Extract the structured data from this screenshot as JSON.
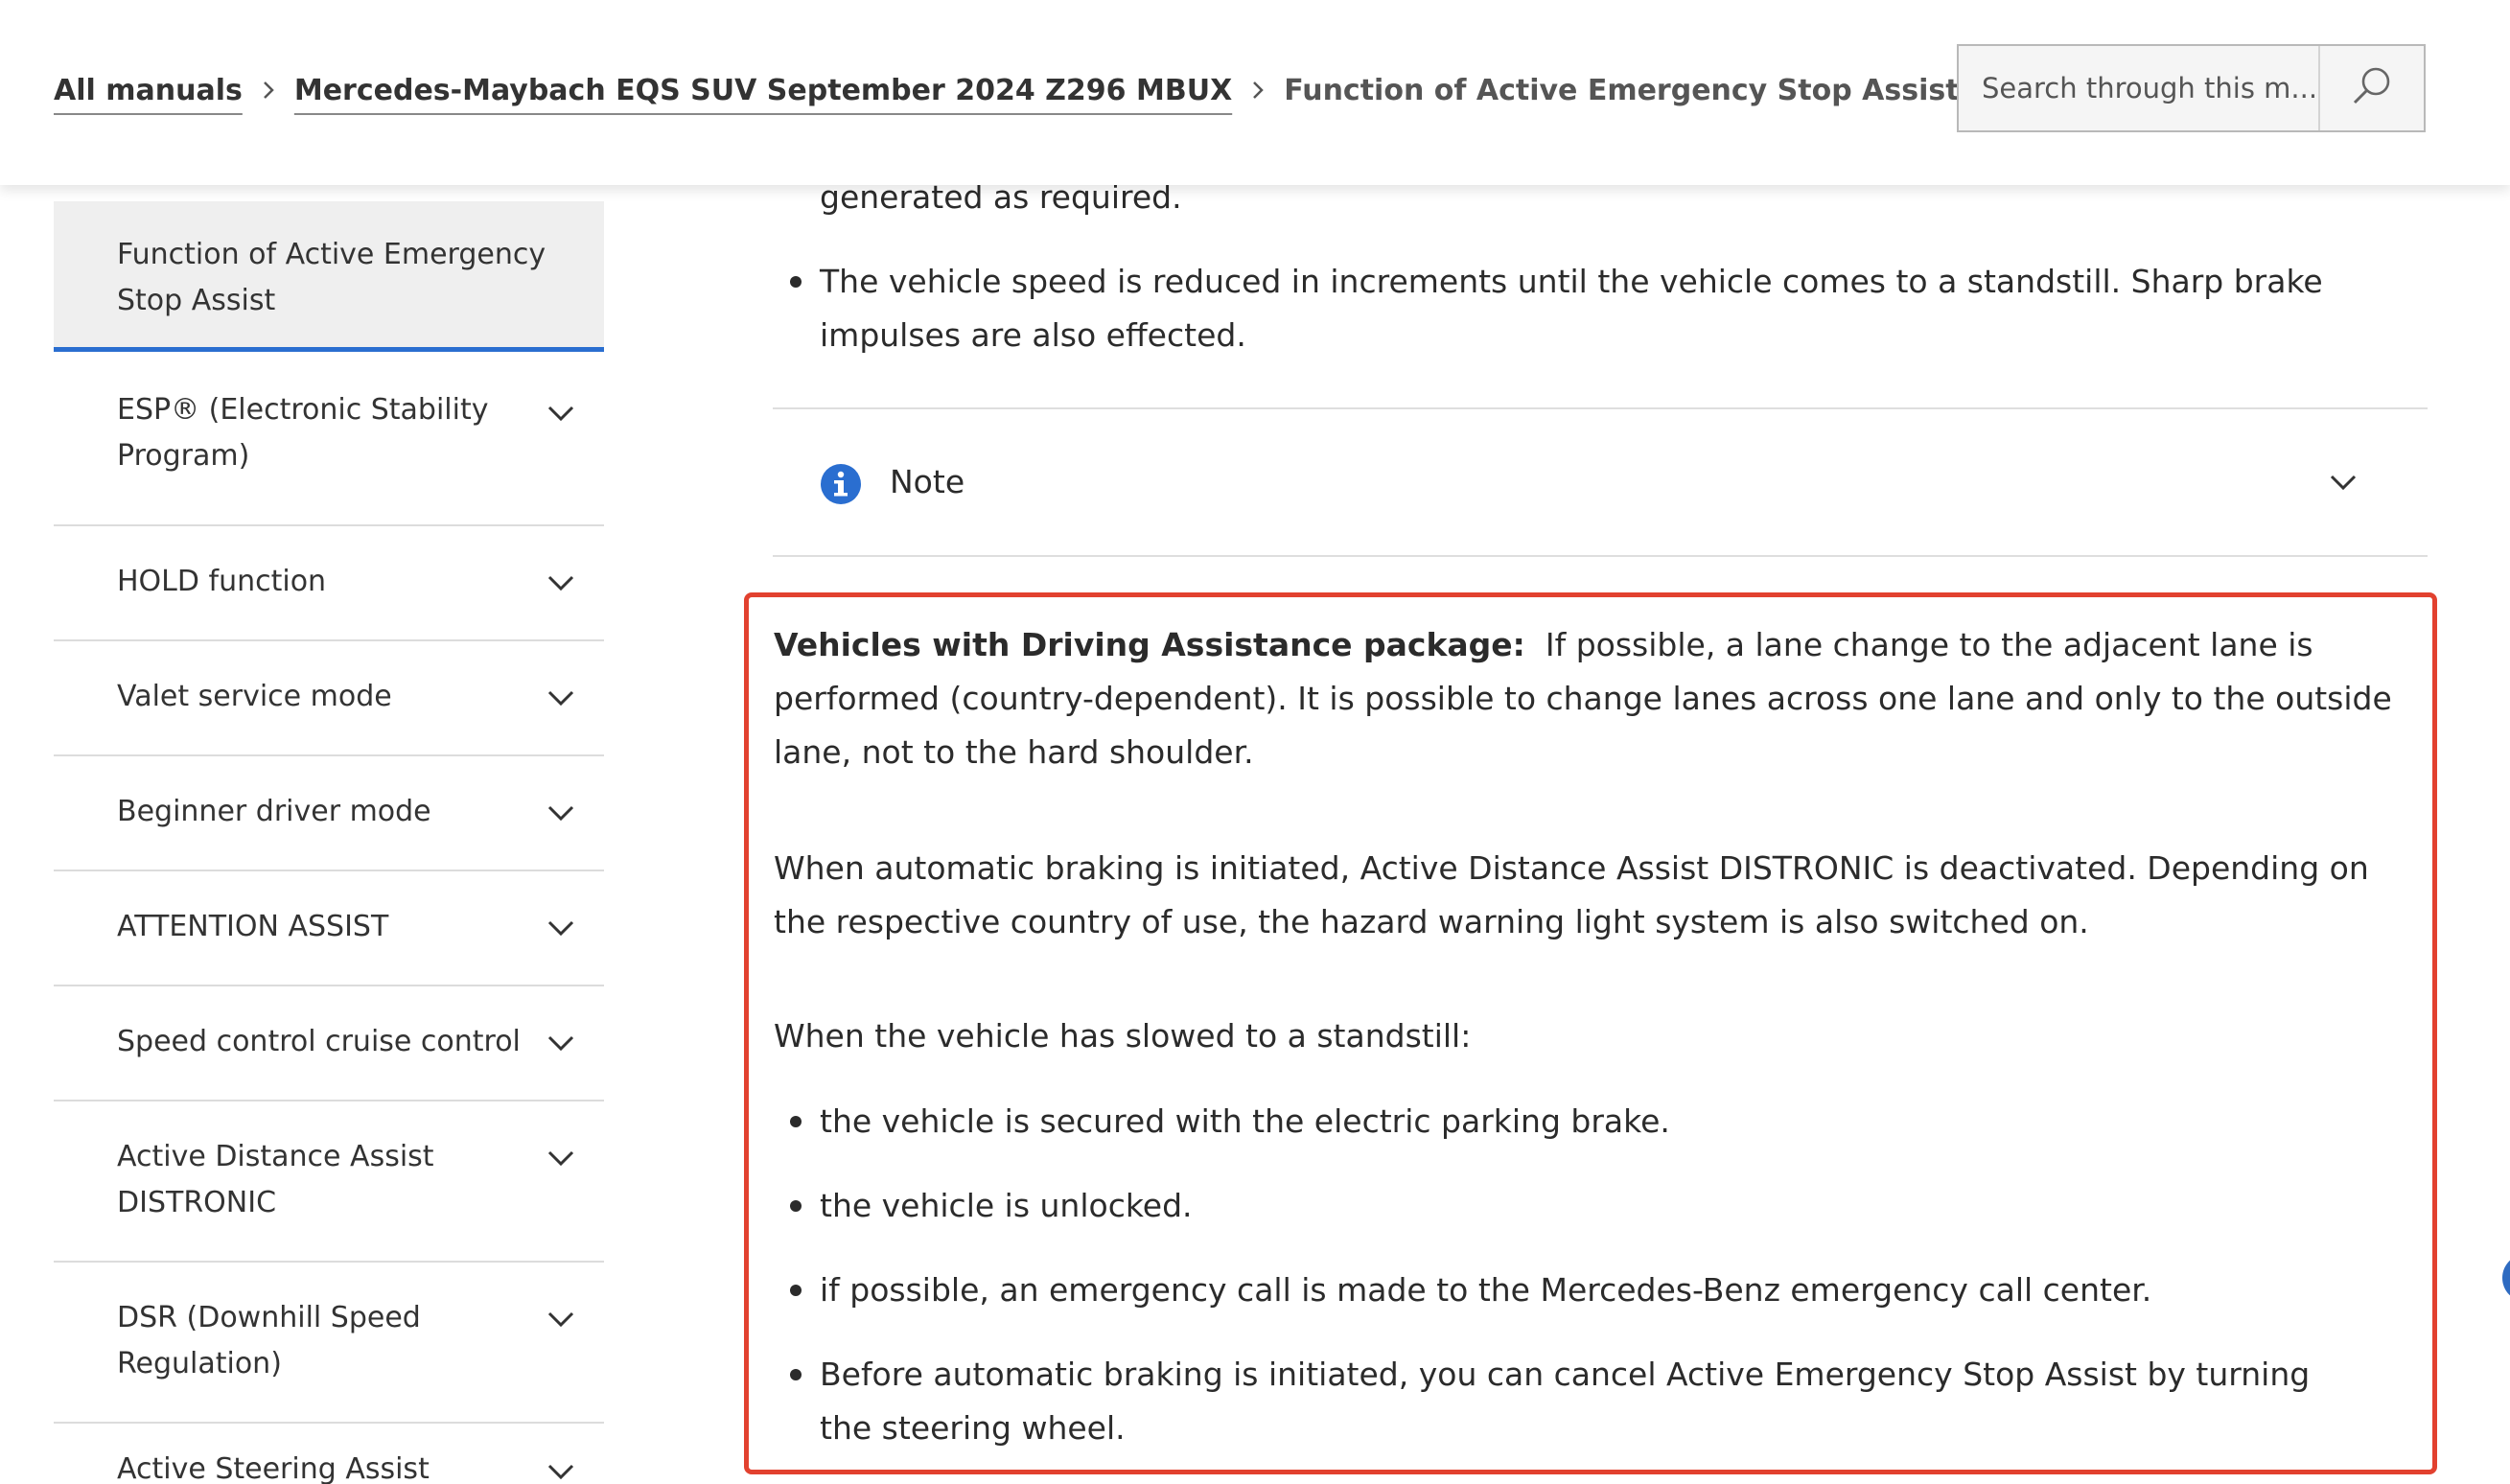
{
  "breadcrumb": {
    "all_manuals": "All manuals",
    "manual": "Mercedes-Maybach EQS SUV September 2024 Z296 MBUX",
    "current": "Function of Active Emergency Stop Assist"
  },
  "search": {
    "placeholder": "Search through this m...",
    "icon": "search-icon"
  },
  "sidebar": {
    "active_item": "Function of Active Emergency Stop Assist",
    "active_color": "#2a6ed0",
    "items": [
      {
        "label": "ESP® (Electronic Stability Program)"
      },
      {
        "label": "HOLD function"
      },
      {
        "label": "Valet service mode"
      },
      {
        "label": "Beginner driver mode"
      },
      {
        "label": "ATTENTION ASSIST"
      },
      {
        "label": "Speed control cruise control"
      },
      {
        "label": "Active Distance Assist DISTRONIC"
      },
      {
        "label": "DSR (Downhill Speed Regulation)"
      },
      {
        "label": "Active Steering Assist"
      }
    ]
  },
  "content": {
    "top_fragment": "generated as required.",
    "top_bullet": "The vehicle speed is reduced in increments until the vehicle comes to a standstill. Sharp brake impulses are also effected.",
    "note": {
      "label": "Note",
      "icon": "info-icon",
      "icon_color": "#2a6ed0"
    },
    "highlighted": {
      "border_color": "#e2412f",
      "lead_bold": "Vehicles with Driving Assistance package:",
      "lead_text": "If possible, a lane change to the adjacent lane is performed (country-dependent). It is possible to change lanes across one lane and only to the outside lane, not to the hard shoulder.",
      "paragraph2": "When automatic braking is initiated, Active Distance Assist DISTRONIC is deactivated. Depending on the respective country of use, the hazard warning light system is also switched on.",
      "paragraph3": "When the vehicle has slowed to a standstill:",
      "bullets": [
        "the vehicle is secured with the electric parking brake.",
        "the vehicle is unlocked.",
        "if possible, an emergency call is made to the Mercedes-Benz emergency call center.",
        "Before automatic braking is initiated, you can cancel Active Emergency Stop Assist by turning the steering wheel."
      ]
    }
  }
}
